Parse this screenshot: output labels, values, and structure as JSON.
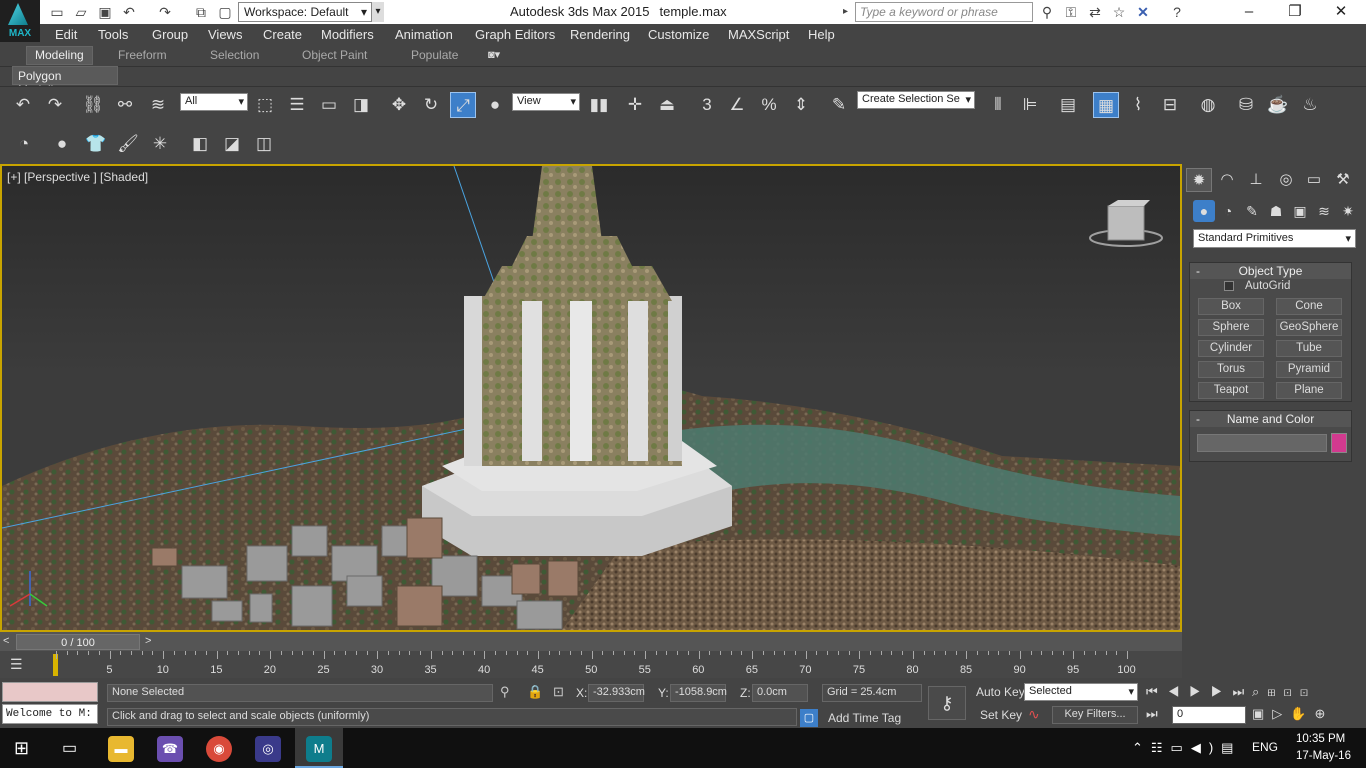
{
  "app": {
    "logo_text": "MAX",
    "title_app": "Autodesk 3ds Max  2015",
    "title_file": "temple.max"
  },
  "workspace": {
    "label": "Workspace: Default"
  },
  "search": {
    "placeholder": "Type a keyword or phrase"
  },
  "menu": [
    "Edit",
    "Tools",
    "Group",
    "Views",
    "Create",
    "Modifiers",
    "Animation",
    "Graph Editors",
    "Rendering",
    "Customize",
    "MAXScript",
    "Help"
  ],
  "ribbon_tabs": [
    "Modeling",
    "Freeform",
    "Selection",
    "Object Paint",
    "Populate"
  ],
  "ribbon_panel": "Polygon Modeling",
  "toolbar": {
    "selection_filter": "All",
    "ref_coord": "View",
    "snap_value": "3",
    "named_selection": "Create Selection Se"
  },
  "viewport": {
    "label": "[+] [Perspective ] [Shaded]"
  },
  "command_panel": {
    "category": "Standard Primitives",
    "object_type_title": "Object Type",
    "autogrid": "AutoGrid",
    "buttons": [
      "Box",
      "Cone",
      "Sphere",
      "GeoSphere",
      "Cylinder",
      "Tube",
      "Torus",
      "Pyramid",
      "Teapot",
      "Plane"
    ],
    "name_color_title": "Name and Color",
    "swatch_color": "#d23a8f"
  },
  "timeline": {
    "slider": "0 / 100",
    "ticks": [
      "5",
      "10",
      "15",
      "20",
      "25",
      "30",
      "35",
      "40",
      "45",
      "50",
      "55",
      "60",
      "65",
      "70",
      "75",
      "80",
      "85",
      "90",
      "95",
      "100"
    ]
  },
  "status": {
    "welcome": "Welcome to M:",
    "selection": "None Selected",
    "prompt": "Click and drag to select and scale objects (uniformly)",
    "x_label": "X:",
    "x": "-32.933cm",
    "y_label": "Y:",
    "y": "-1058.9cm",
    "z_label": "Z:",
    "z": "0.0cm",
    "grid": "Grid = 25.4cm",
    "add_time_tag": "Add Time Tag",
    "auto_key": "Auto Key",
    "set_key": "Set Key",
    "key_mode": "Selected",
    "key_filters": "Key Filters...",
    "frame": "0"
  },
  "taskbar": {
    "time": "10:35 PM",
    "date": "17-May-16",
    "lang": "ENG"
  }
}
